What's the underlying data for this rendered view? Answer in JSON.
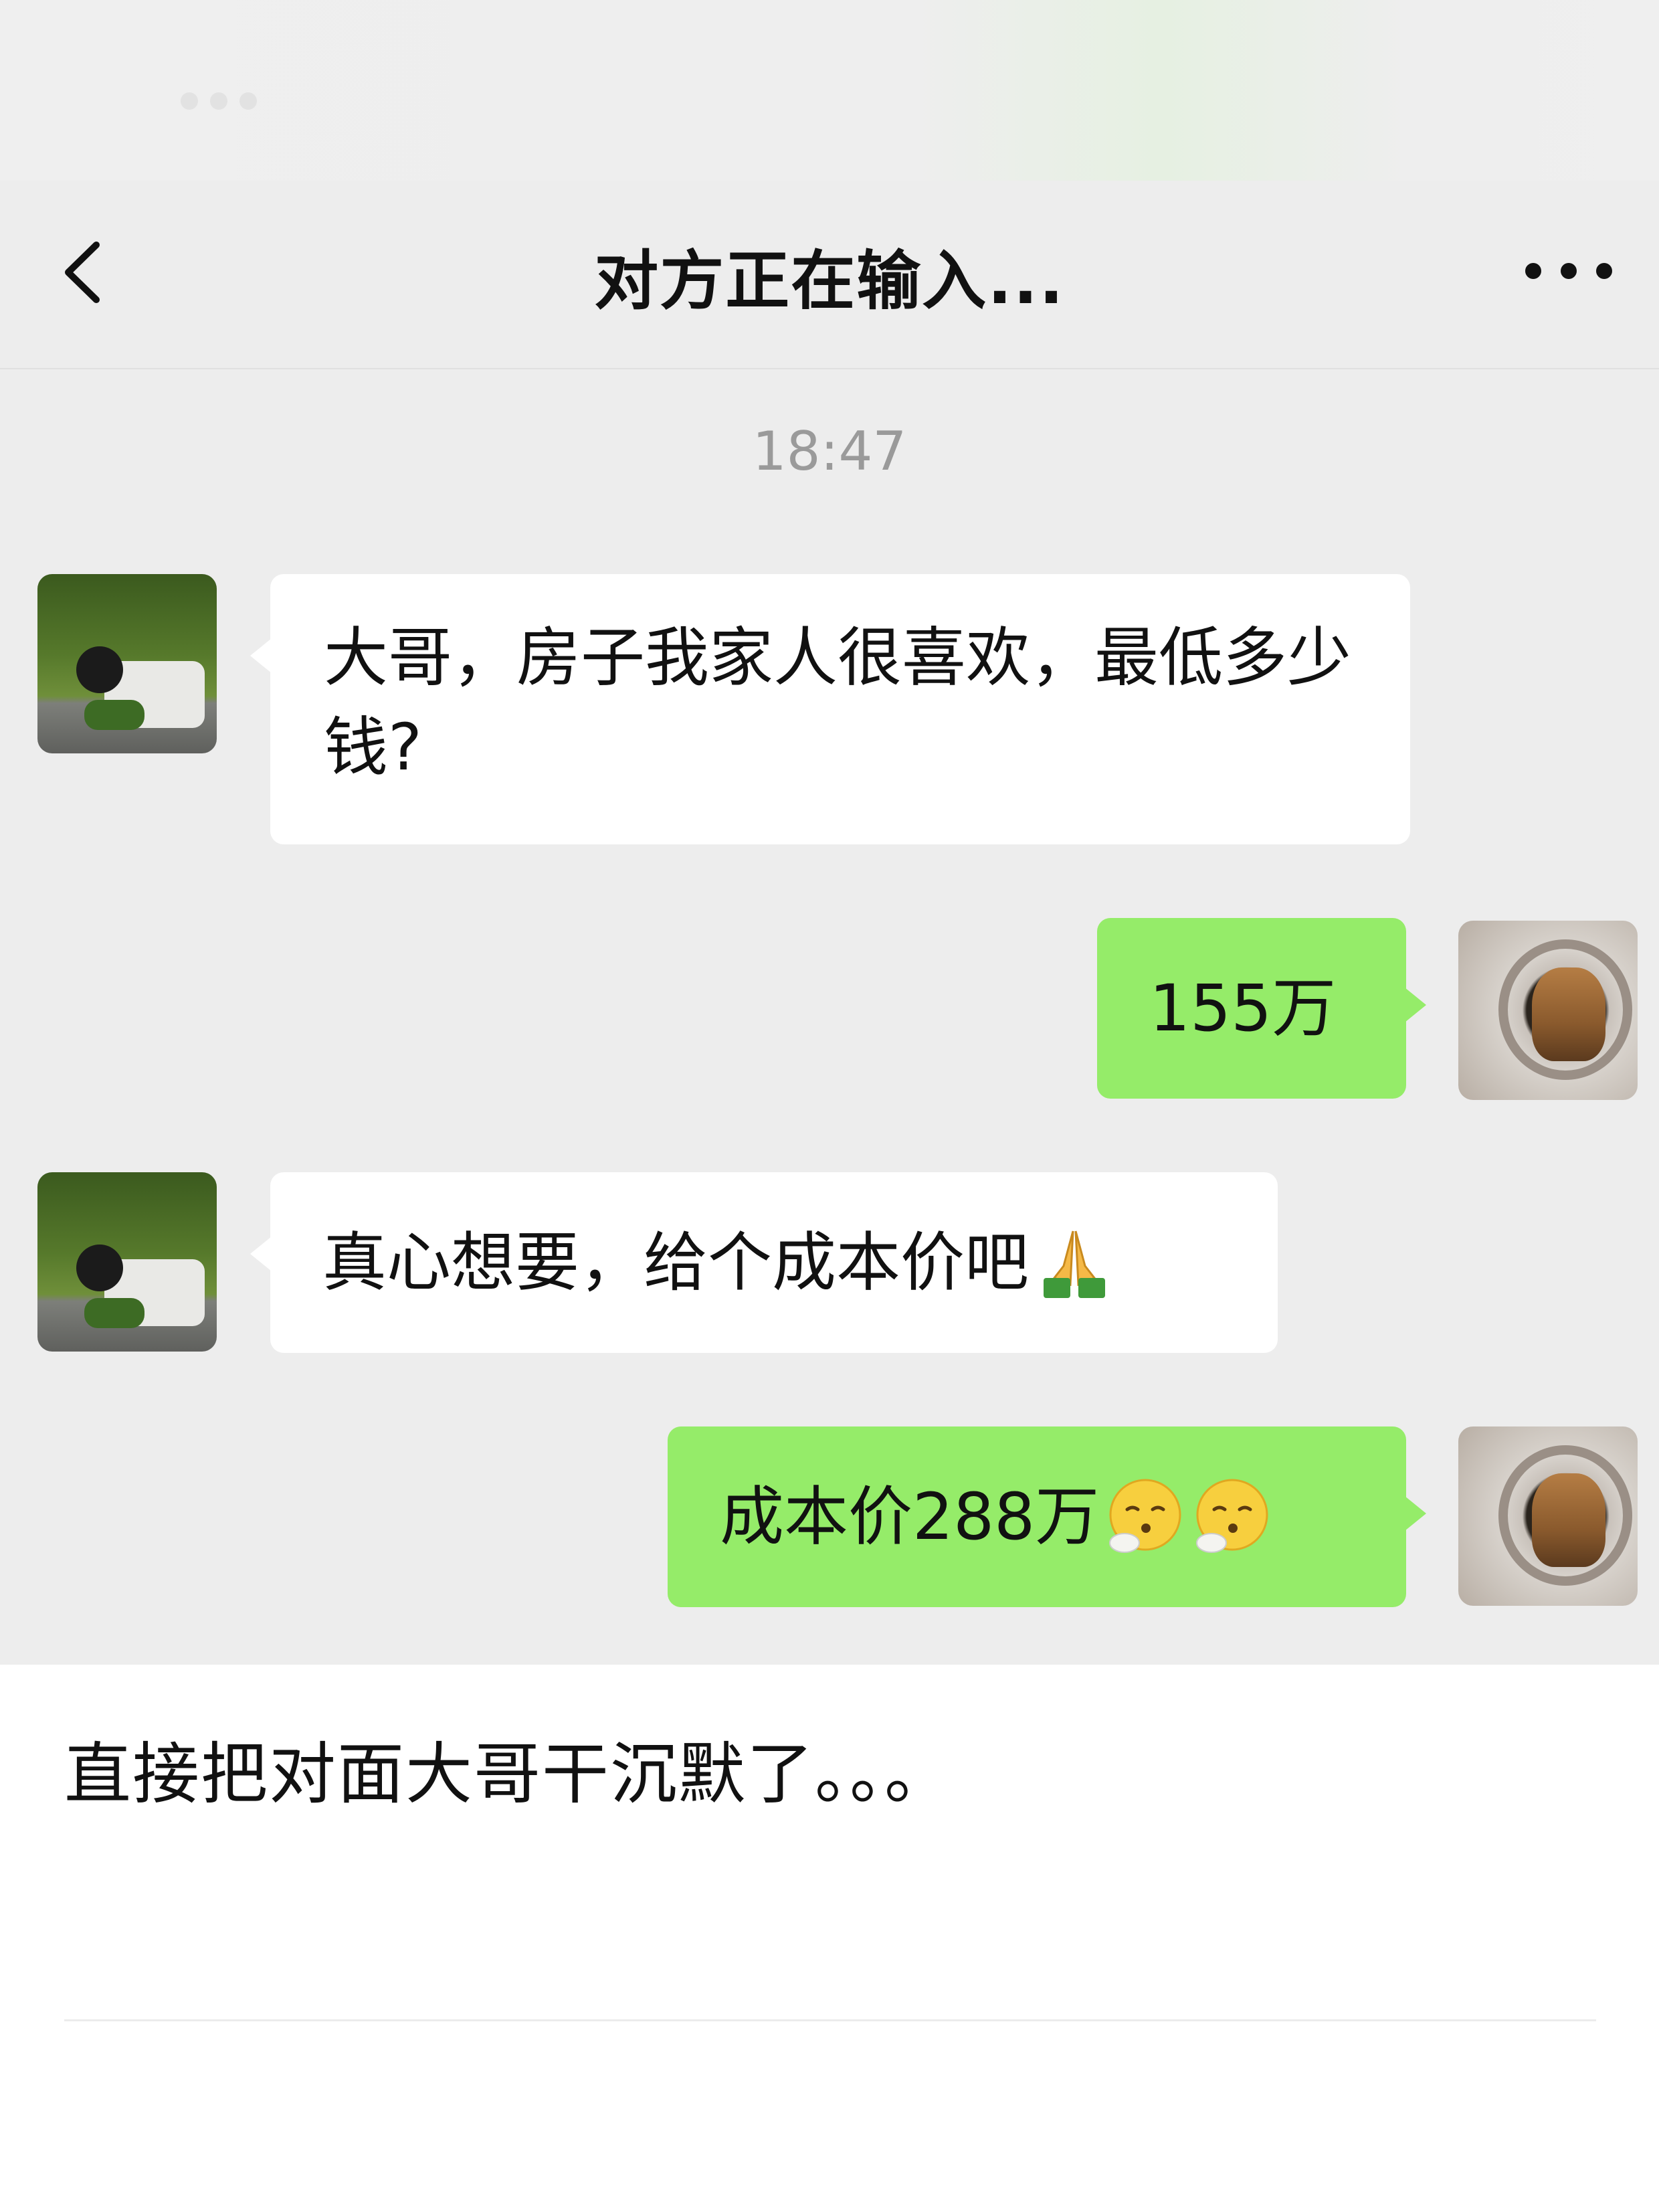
{
  "nav": {
    "back_icon": "chevron-left-icon",
    "title": "对方正在输入...",
    "more_icon": "more-dots-icon"
  },
  "chat": {
    "timestamp": "18:47",
    "messages": [
      {
        "sender": "other",
        "text": "大哥，房子我家人很喜欢，最低多少钱?"
      },
      {
        "sender": "self",
        "text": "155万"
      },
      {
        "sender": "other",
        "text": "真心想要，给个成本价吧",
        "emoji": "praying-hands"
      },
      {
        "sender": "self",
        "text": "成本价288万",
        "emoji": "smirk-face x2"
      }
    ]
  },
  "caption": "直接把对面大哥干沉默了。。。",
  "colors": {
    "chat_background": "#ededed",
    "sent_bubble": "#95ec69",
    "received_bubble": "#ffffff",
    "timestamp_text": "#9a9a9a"
  }
}
